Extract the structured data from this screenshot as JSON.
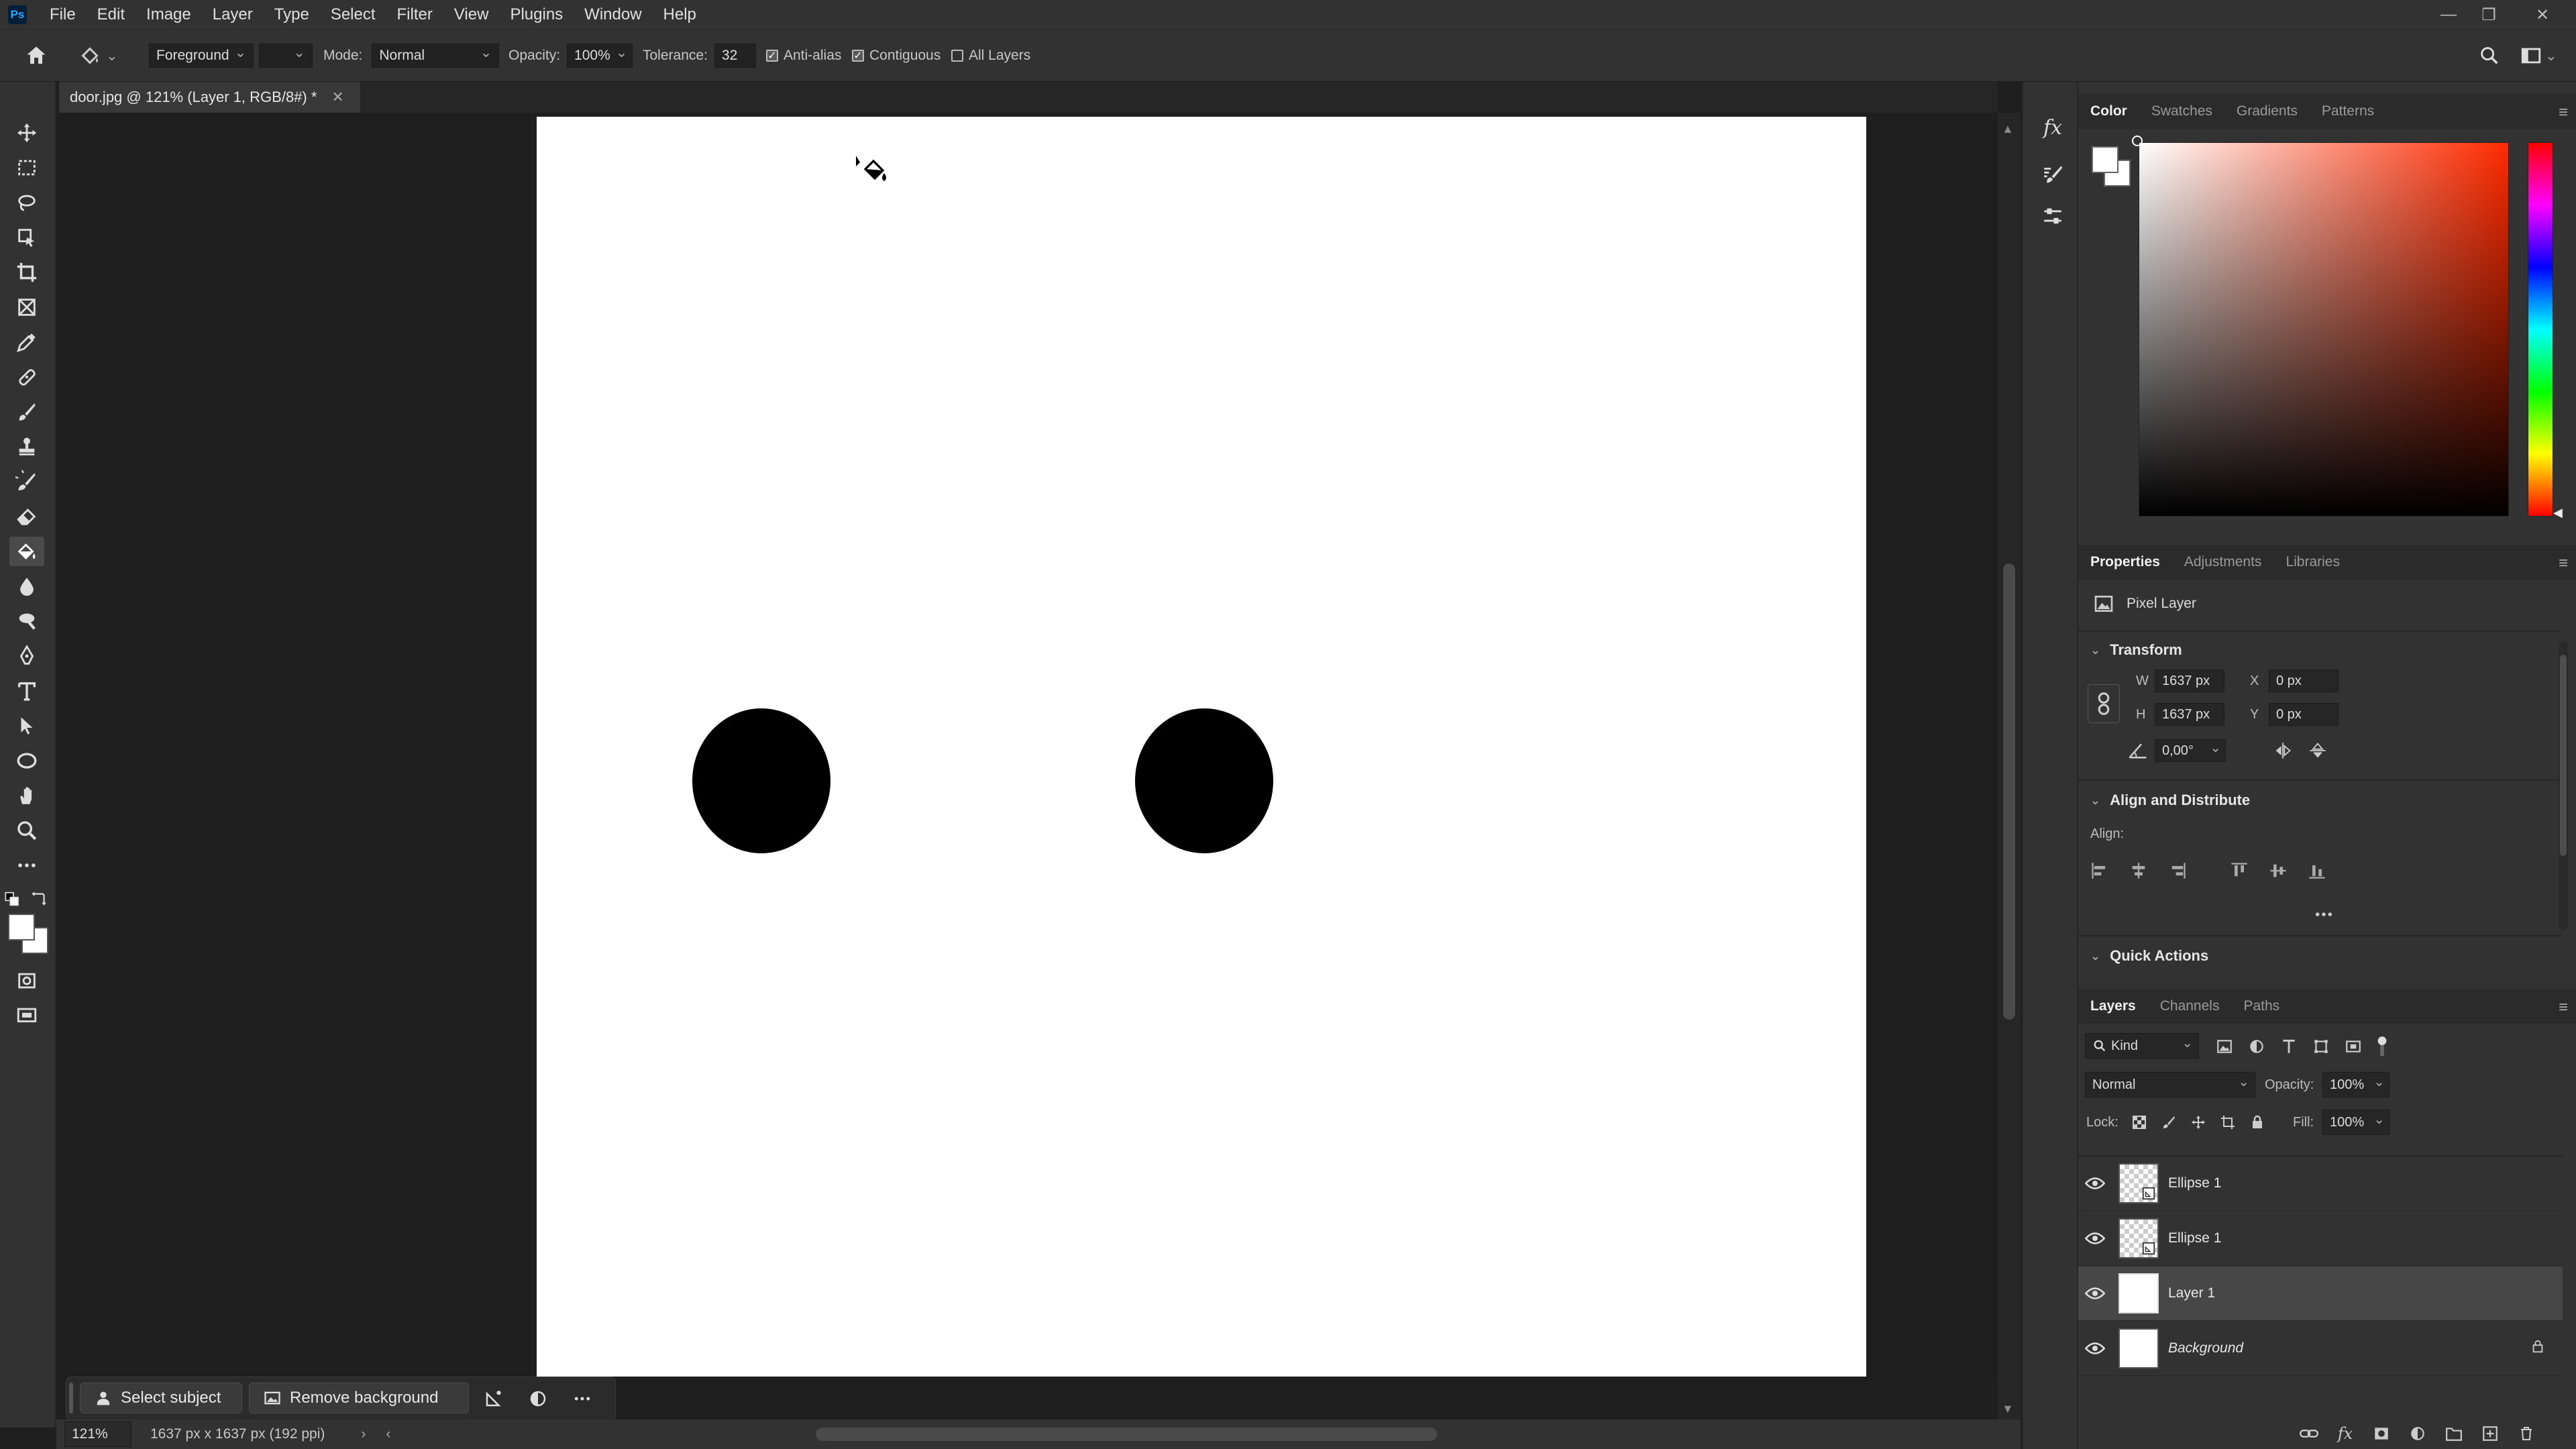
{
  "app": {
    "logo": "Ps",
    "menu": [
      "File",
      "Edit",
      "Image",
      "Layer",
      "Type",
      "Select",
      "Filter",
      "View",
      "Plugins",
      "Window",
      "Help"
    ]
  },
  "options": {
    "fill_source": "Foreground",
    "mode_label": "Mode:",
    "mode_value": "Normal",
    "opacity_label": "Opacity:",
    "opacity_value": "100%",
    "tolerance_label": "Tolerance:",
    "tolerance_value": "32",
    "anti_alias": "Anti-alias",
    "contiguous": "Contiguous",
    "all_layers": "All Layers"
  },
  "document": {
    "tab_title": "door.jpg @ 121% (Layer 1, RGB/8#) *"
  },
  "taskbar": {
    "select_subject": "Select subject",
    "remove_background": "Remove background"
  },
  "status": {
    "zoom": "121%",
    "doc_info": "1637 px x 1637 px (192 ppi)"
  },
  "color_panel": {
    "tabs": [
      "Color",
      "Swatches",
      "Gradients",
      "Patterns"
    ],
    "accent_hue": "#ff2a00"
  },
  "properties_panel": {
    "tabs": [
      "Properties",
      "Adjustments",
      "Libraries"
    ],
    "layer_type": "Pixel Layer",
    "transform_title": "Transform",
    "w_label": "W",
    "w_value": "1637 px",
    "h_label": "H",
    "h_value": "1637 px",
    "x_label": "X",
    "x_value": "0 px",
    "y_label": "Y",
    "y_value": "0 px",
    "angle_value": "0,00°",
    "align_title": "Align and Distribute",
    "align_label": "Align:",
    "quick_actions_title": "Quick Actions"
  },
  "layers_panel": {
    "tabs": [
      "Layers",
      "Channels",
      "Paths"
    ],
    "filter_kind": "Kind",
    "blend_mode": "Normal",
    "opacity_label": "Opacity:",
    "opacity_value": "100%",
    "lock_label": "Lock:",
    "fill_label": "Fill:",
    "fill_value": "100%",
    "layers": [
      {
        "name": "Ellipse 1"
      },
      {
        "name": "Ellipse 1"
      },
      {
        "name": "Layer 1"
      },
      {
        "name": "Background"
      }
    ]
  }
}
